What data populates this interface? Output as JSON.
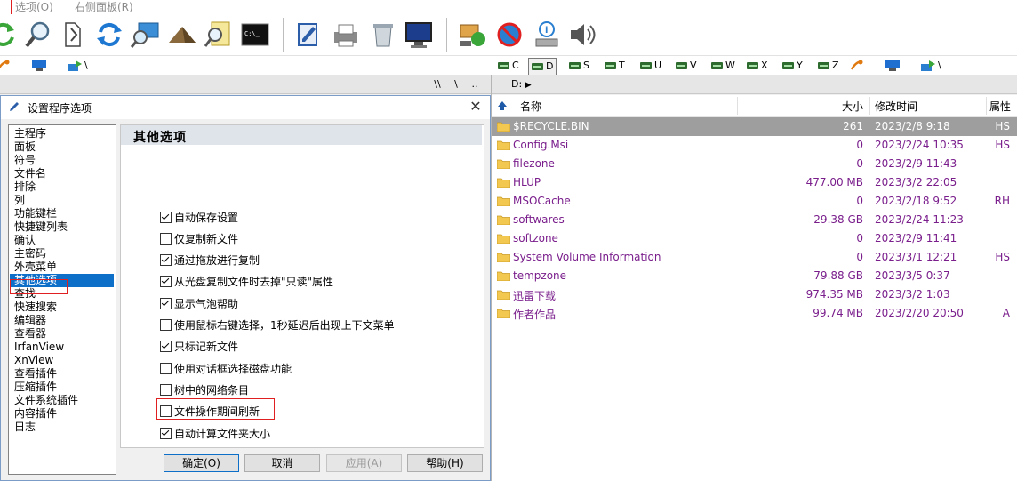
{
  "menu": {
    "options": "选项(O)",
    "right_panel": "右侧面板(R)"
  },
  "drive_bar": {
    "left": [
      {
        "icon": "favorites-icon"
      },
      {
        "icon": "monitor-icon"
      },
      {
        "icon": "network-path-icon",
        "label": "\\"
      }
    ],
    "right": [
      {
        "label": "C"
      },
      {
        "label": "D",
        "active": true
      },
      {
        "label": "S"
      },
      {
        "label": "T"
      },
      {
        "label": "U"
      },
      {
        "label": "V"
      },
      {
        "label": "W"
      },
      {
        "label": "X"
      },
      {
        "label": "Y"
      },
      {
        "label": "Z"
      }
    ],
    "right_tail": "\\"
  },
  "left_path": {
    "btn1": "\\\\",
    "btn2": "\\",
    "btn3": ".."
  },
  "right_path": {
    "text": "D:"
  },
  "dialog": {
    "title": "设置程序选项",
    "close": "✕",
    "nav": [
      "主程序",
      "面板",
      "符号",
      "文件名",
      "排除",
      "列",
      "功能键栏",
      "快捷键列表",
      "确认",
      "主密码",
      "外壳菜单",
      "其他选项",
      "查找",
      "快速搜索",
      "编辑器",
      "查看器",
      "IrfanView",
      "XnView",
      "查看插件",
      "压缩插件",
      "文件系统插件",
      "内容插件",
      "日志"
    ],
    "nav_selected": 11,
    "panel_title": "其他选项",
    "options": [
      {
        "label": "自动保存设置",
        "checked": true
      },
      {
        "label": "仅复制新文件",
        "checked": false
      },
      {
        "label": "通过拖放进行复制",
        "checked": true
      },
      {
        "label": "从光盘复制文件时去掉\"只读\"属性",
        "checked": true
      },
      {
        "label": "显示气泡帮助",
        "checked": true
      },
      {
        "label": "使用鼠标右键选择，1秒延迟后出现上下文菜单",
        "checked": false
      },
      {
        "label": "只标记新文件",
        "checked": true
      },
      {
        "label": "使用对话框选择磁盘功能",
        "checked": false
      },
      {
        "label": "树中的网络条目",
        "checked": false
      },
      {
        "label": "文件操作期间刷新",
        "checked": false
      },
      {
        "label": "自动计算文件夹大小",
        "checked": true
      }
    ],
    "buttons": {
      "ok": "确定(O)",
      "cancel": "取消",
      "apply": "应用(A)",
      "help": "帮助(H)"
    }
  },
  "file_list": {
    "headers": {
      "name": "名称",
      "size": "大小",
      "modified": "修改时间",
      "attr": "属性"
    },
    "rows": [
      {
        "name": "$RECYCLE.BIN",
        "size": "261",
        "date": "2023/2/8  9:18",
        "attr": "HS",
        "selected": true
      },
      {
        "name": "Config.Msi",
        "size": "0",
        "date": "2023/2/24  10:35",
        "attr": "HS"
      },
      {
        "name": "filezone",
        "size": "0",
        "date": "2023/2/9  11:43",
        "attr": ""
      },
      {
        "name": "HLUP",
        "size": "477.00 MB",
        "date": "2023/3/2  22:05",
        "attr": ""
      },
      {
        "name": "MSOCache",
        "size": "0",
        "date": "2023/2/18  9:52",
        "attr": "RH"
      },
      {
        "name": "softwares",
        "size": "29.38 GB",
        "date": "2023/2/24  11:23",
        "attr": ""
      },
      {
        "name": "softzone",
        "size": "0",
        "date": "2023/2/9  11:41",
        "attr": ""
      },
      {
        "name": "System Volume Information",
        "size": "0",
        "date": "2023/3/1  12:21",
        "attr": "HS"
      },
      {
        "name": "tempzone",
        "size": "79.88 GB",
        "date": "2023/3/5  0:37",
        "attr": ""
      },
      {
        "name": "迅雷下载",
        "size": "974.35 MB",
        "date": "2023/3/2  1:03",
        "attr": ""
      },
      {
        "name": "作者作品",
        "size": "99.74 MB",
        "date": "2023/2/20  20:50",
        "attr": "A"
      }
    ]
  },
  "colors": {
    "accent": "#0e6fc9",
    "highlight": "#e02020",
    "file_text": "#7a1e8c",
    "selected_row": "#9e9e9e"
  }
}
